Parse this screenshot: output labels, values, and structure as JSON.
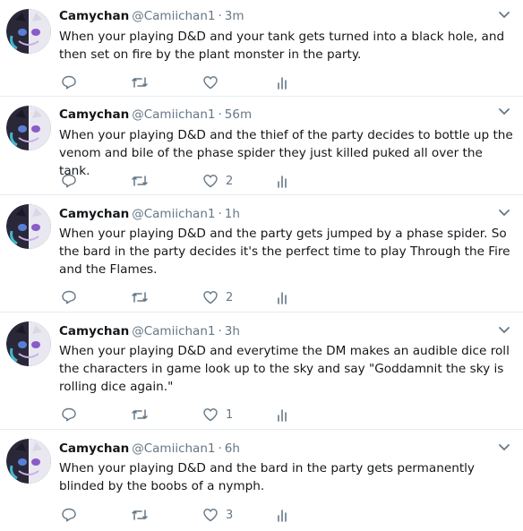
{
  "colors": {
    "text": "#14171a",
    "muted": "#657786",
    "icon": "#657786",
    "divider": "#e6ecf0"
  },
  "icons": {
    "reply": "reply-icon",
    "retweet": "retweet-icon",
    "like": "heart-icon",
    "analytics": "analytics-icon",
    "more": "chevron-down-icon"
  },
  "tweets": [
    {
      "name": "Camychan",
      "handle": "@Camiichan1",
      "separator": "·",
      "time": "3m",
      "text": "When your playing D&D and your tank gets turned into a black hole, and then set on fire by the plant monster in the party.",
      "likes": ""
    },
    {
      "name": "Camychan",
      "handle": "@Camiichan1",
      "separator": "·",
      "time": "56m",
      "text": "When your playing D&D and the thief of the party decides to bottle up the venom and bile of the phase spider they just killed puked all over the tank.",
      "likes": "2"
    },
    {
      "name": "Camychan",
      "handle": "@Camiichan1",
      "separator": "·",
      "time": "1h",
      "text": "When your playing D&D and the party gets jumped by a phase spider. So the bard in the party decides it's the perfect time to play Through the Fire and the Flames.",
      "likes": "2"
    },
    {
      "name": "Camychan",
      "handle": "@Camiichan1",
      "separator": "·",
      "time": "3h",
      "text": "When your playing D&D and everytime the DM makes an audible dice roll the characters in game look up to the sky and say \"Goddamnit the sky is rolling dice again.\"",
      "likes": "1"
    },
    {
      "name": "Camychan",
      "handle": "@Camiichan1",
      "separator": "·",
      "time": "6h",
      "text": "When your playing D&D and the bard in the party gets permanently blinded by the boobs of a nymph.",
      "likes": "3"
    }
  ]
}
